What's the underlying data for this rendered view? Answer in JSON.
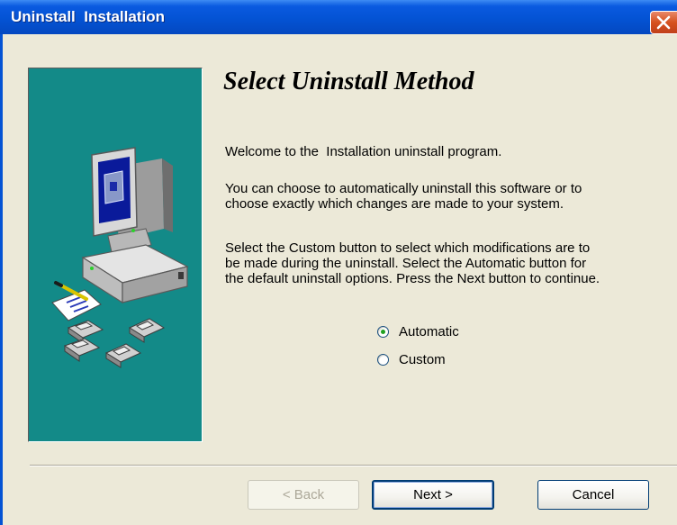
{
  "window": {
    "title": "Uninstall  Installation",
    "accent_color": "#0453d4",
    "close_icon": "close-icon"
  },
  "panel": {
    "illustration": "computer-with-floppy-disks-illustration",
    "panel_color": "#138a88"
  },
  "content": {
    "heading": "Select Uninstall Method",
    "paragraphs": [
      "Welcome to the  Installation uninstall program.",
      "You can choose to automatically uninstall this software or to\nchoose exactly which changes are made to your system.",
      "Select the Custom button to select which modifications are to\nbe made during the uninstall. Select the Automatic button for\nthe default uninstall options. Press the Next button to continue."
    ],
    "options": [
      {
        "label": "Automatic",
        "checked": true
      },
      {
        "label": "Custom",
        "checked": false
      }
    ]
  },
  "buttons": {
    "back": "< Back",
    "back_enabled": false,
    "next": "Next >",
    "cancel": "Cancel"
  }
}
